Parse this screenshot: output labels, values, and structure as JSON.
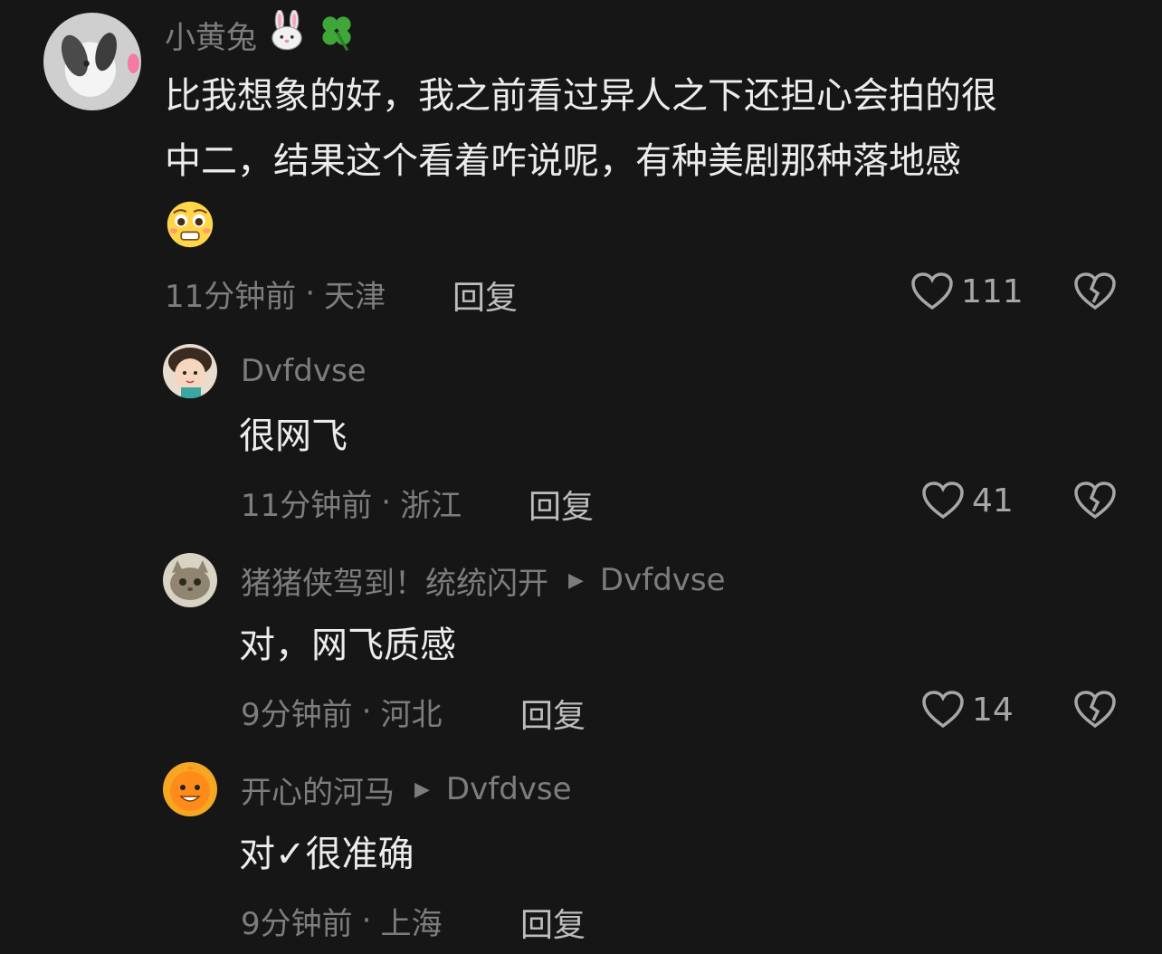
{
  "comments": [
    {
      "username": "小黄兔",
      "name_emoji": [
        "rabbit-face-emoji",
        "four-leaf-clover-emoji"
      ],
      "text_line1": "比我想象的好，我之前看过异人之下还担心会拍的很",
      "text_line2": "中二，结果这个看着咋说呢，有种美剧那种落地感",
      "text_emoji": "pleading-face-emoji",
      "time": "11分钟前",
      "location": "天津",
      "reply_label": "回复",
      "likes": "111"
    },
    {
      "username": "Dvfdvse",
      "text": "很网飞",
      "time": "11分钟前",
      "location": "浙江",
      "reply_label": "回复",
      "likes": "41"
    },
    {
      "username": "猪猪侠驾到！统统闪开",
      "reply_to": "Dvfdvse",
      "text": "对，网飞质感",
      "time": "9分钟前",
      "location": "河北",
      "reply_label": "回复",
      "likes": "14"
    },
    {
      "username": "开心的河马",
      "reply_to": "Dvfdvse",
      "text": "对✓很准确",
      "time": "9分钟前",
      "location": "上海",
      "reply_label": "回复"
    }
  ],
  "separator": "·",
  "reply_arrow": "▶",
  "icons": {
    "like": "heart-outline-icon",
    "dislike": "broken-heart-icon"
  }
}
